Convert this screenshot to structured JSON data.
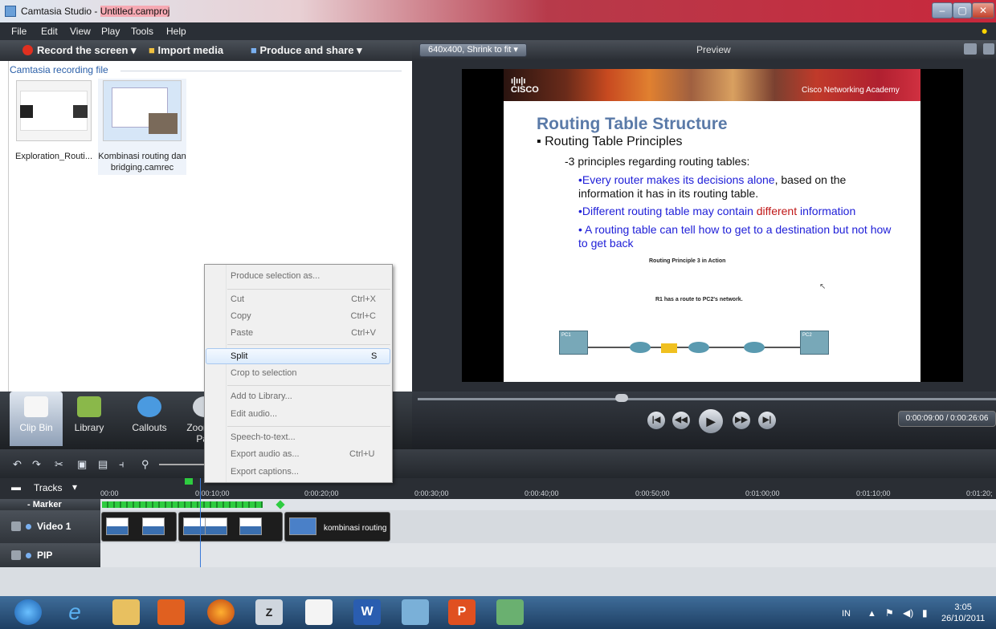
{
  "window": {
    "app_title": "Camtasia Studio - ",
    "project_name": "Untitled.camproj",
    "minimize": "–",
    "maximize": "▢",
    "close": "✕"
  },
  "menu": [
    "File",
    "Edit",
    "View",
    "Play",
    "Tools",
    "Help"
  ],
  "toolbar": {
    "record": "Record the screen",
    "import": "Import media",
    "produce": "Produce and share"
  },
  "clip_bin": {
    "header": "Camtasia recording file",
    "clips": [
      {
        "label": "Exploration_Routi..."
      },
      {
        "label": "Kombinasi routing dan bridging.camrec"
      }
    ]
  },
  "preview": {
    "size_option": "640x400, Shrink to fit",
    "label": "Preview"
  },
  "slide": {
    "academy": "Cisco Networking Academy",
    "title": "Routing Table Structure",
    "subtitle": "Routing Table Principles",
    "intro": "-3 principles regarding routing tables:",
    "b1_blue": "•Every router makes its decisions alone",
    "b1_rest": ", based on the information it has in its routing table.",
    "b2_a": "•Different routing table may contain ",
    "b2_red": "different",
    "b2_b": " information",
    "b3": "• A routing table can tell how to get to a destination but not how to get back",
    "cap1": "Routing Principle 3 in Action",
    "cap2": "R1 has a route to PC2's network.",
    "pc1": "PC1",
    "pc2": "PC2"
  },
  "player": {
    "timecode": "0:00:09:00 / 0:00:26:06"
  },
  "tabs": [
    {
      "label": "Clip Bin"
    },
    {
      "label": "Library"
    },
    {
      "label": "Callouts"
    },
    {
      "label": "Zoom-n-Pan"
    }
  ],
  "timeline": {
    "tracks_label": "Tracks",
    "ticks": [
      "00:00",
      "0:00:10;00",
      "0:00:20;00",
      "0:00:30;00",
      "0:00:40;00",
      "0:00:50;00",
      "0:01:00;00",
      "0:01:10;00",
      "0:01:20;"
    ],
    "marker_label": "Marker",
    "video_label": "Video 1",
    "pip_label": "PIP",
    "clip_name": "kombinasi routing"
  },
  "context_menu": {
    "produce_selection": "Produce selection as...",
    "cut": "Cut",
    "cut_sc": "Ctrl+X",
    "copy": "Copy",
    "copy_sc": "Ctrl+C",
    "paste": "Paste",
    "paste_sc": "Ctrl+V",
    "split": "Split",
    "split_sc": "S",
    "crop": "Crop to selection",
    "add_library": "Add to Library...",
    "edit_audio": "Edit audio...",
    "speech": "Speech-to-text...",
    "export_audio": "Export audio as...",
    "export_audio_sc": "Ctrl+U",
    "export_captions": "Export captions..."
  },
  "taskbar": {
    "lang": "IN",
    "time": "3:05",
    "date": "26/10/2011"
  },
  "colors": {
    "menu_bg": "#2a2f36",
    "accent": "#3a7ad8",
    "title_red": "#c8283c"
  }
}
